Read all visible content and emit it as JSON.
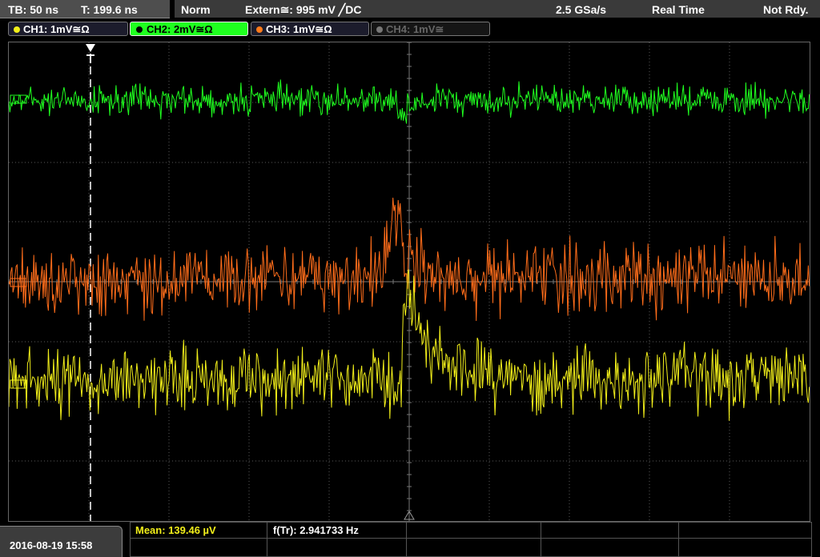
{
  "status": {
    "timebase": "TB: 50 ns",
    "trigger_time": "T: 199.6 ns",
    "mode": "Norm",
    "trigger_source": "Extern≅: 995 mV ╱DC",
    "sample_rate": "2.5 GSa/s",
    "acquisition": "Real Time",
    "state": "Not Rdy."
  },
  "channels": [
    {
      "label": "CH1: 1mV≅Ω",
      "color": "#f2ef1a",
      "active": false,
      "enabled": true
    },
    {
      "label": "CH2: 2mV≅Ω",
      "color": "#1fff1f",
      "active": true,
      "enabled": true
    },
    {
      "label": "CH3: 1mV≅Ω",
      "color": "#ff7a1a",
      "active": false,
      "enabled": true
    },
    {
      "label": "CH4: 1mV≅",
      "color": "#777777",
      "active": false,
      "enabled": false
    }
  ],
  "bottom": {
    "datetime": "2016-08-19 15:58",
    "mean": "Mean: 139.46 µV",
    "freq": "f(Tr): 2.941733 Hz"
  },
  "colors": {
    "grid": "#5a5a5a",
    "ch1": "#f2ef1a",
    "ch2": "#1fff1f",
    "ch3": "#ff6d1a",
    "trigger_marker": "#ffffff"
  },
  "icons": {
    "trigger_position": "trigger-t-icon",
    "trigger_level": "trigger-level-triangle-icon"
  }
}
